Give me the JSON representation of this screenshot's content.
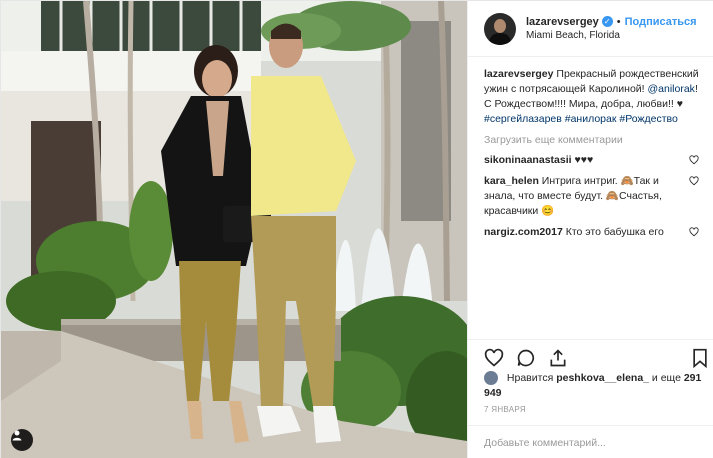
{
  "header": {
    "username": "lazarevsergey",
    "verified_glyph": "✓",
    "separator": "•",
    "follow_label": "Подписаться",
    "location": "Miami Beach, Florida"
  },
  "caption": {
    "username": "lazarevsergey",
    "text_part1": "Прекрасный рождественский ужин с потрясающей Каролиной!",
    "mention": "@anilorak",
    "text_part2": "! С Рождеством!!!! Мира, добра, любви!! ♥",
    "hashtags": "#сергейлазарев #анилорак #Рождество"
  },
  "load_more": "Загрузить еще комментарии",
  "comments": [
    {
      "user": "sikoninaanastasii",
      "text": "♥♥♥"
    },
    {
      "user": "kara_helen",
      "text": "Интрига интриг. 🙈Так и знала, что вместе будут. 🙈Счастья, красавчики 😊"
    },
    {
      "user": "nargiz.com2017",
      "text": "Кто это бабушка его"
    }
  ],
  "likes": {
    "prefix": "Нравится",
    "user": "peshkova__elena_",
    "suffix": "и еще",
    "count": "291 949"
  },
  "date": "7 ЯНВАРЯ",
  "add_comment_placeholder": "Добавьте комментарий...",
  "icons": [
    "heart-icon",
    "comment-icon",
    "share-icon",
    "bookmark-icon",
    "user-tag-icon",
    "verified-icon"
  ],
  "colors": {
    "accent": "#3897f0",
    "text": "#262626",
    "muted": "#999999",
    "link": "#003569"
  }
}
